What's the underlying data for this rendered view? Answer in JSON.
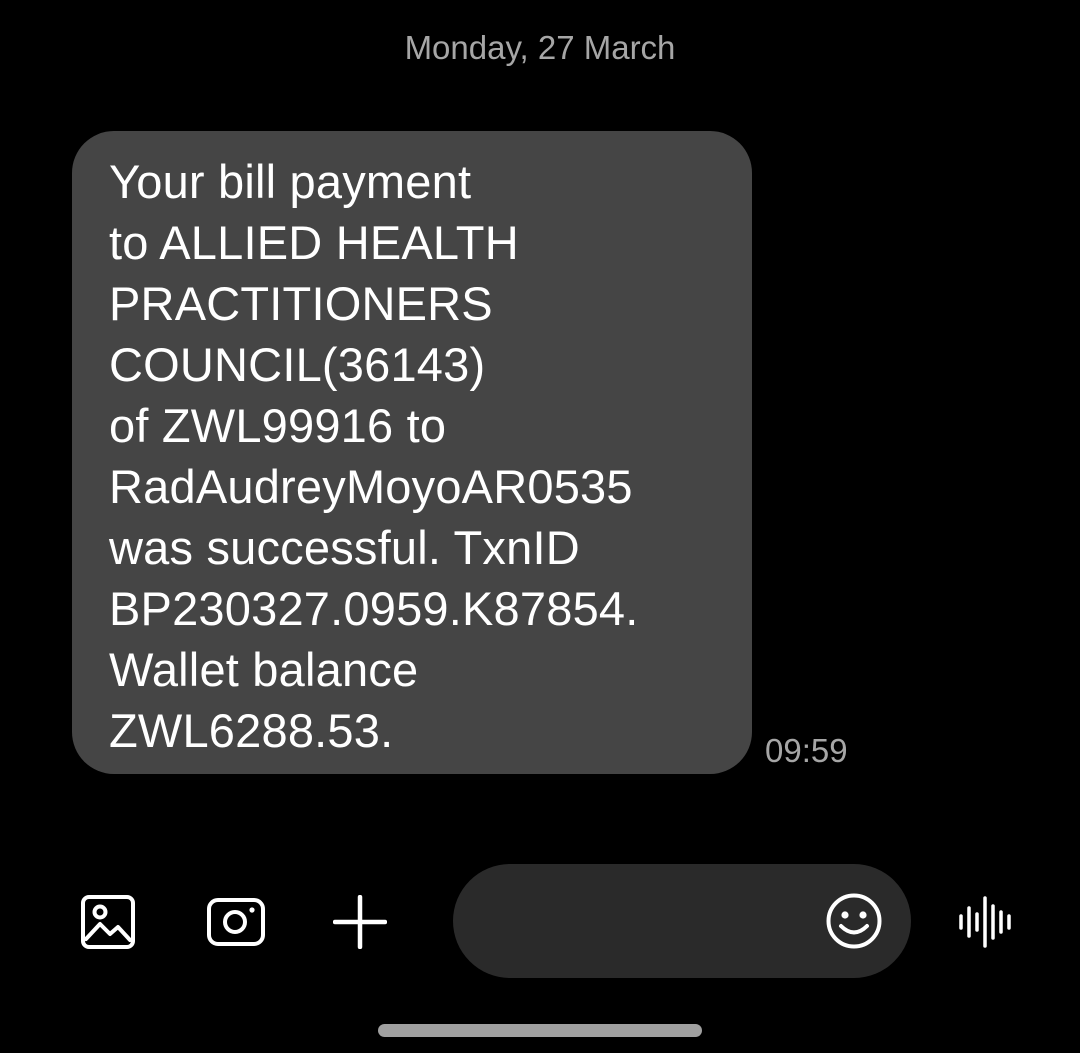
{
  "conversation": {
    "date_header": "Monday, 27 March",
    "messages": [
      {
        "lines": [
          "Your bill payment",
          "to ALLIED HEALTH",
          "PRACTITIONERS",
          "COUNCIL(36143)",
          "of ZWL99916 to",
          "RadAudreyMoyoAR0535",
          "was successful. TxnID",
          "BP230327.0959.K87854.",
          "Wallet balance",
          "ZWL6288.53."
        ],
        "time": "09:59"
      }
    ]
  },
  "composer": {
    "message_input": {
      "value": "",
      "placeholder": ""
    },
    "icons": {
      "gallery": "image-icon",
      "camera": "camera-icon",
      "more": "plus-icon",
      "emoji": "emoji-icon",
      "voice": "voice-waveform-icon"
    }
  },
  "colors": {
    "background": "#000000",
    "bubble": "#454545",
    "input": "#2a2a2a",
    "secondary_text": "#a6a6a6",
    "primary_text": "#ffffff"
  }
}
